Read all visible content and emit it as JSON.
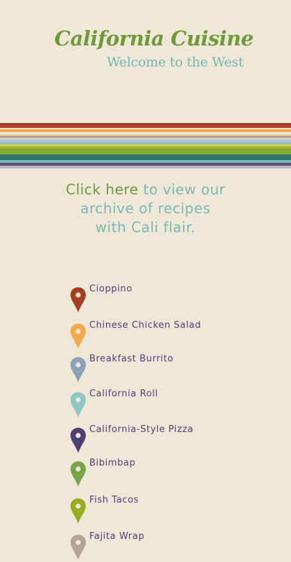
{
  "header": {
    "title": "California Cuisine",
    "tagline": "Welcome to the West"
  },
  "stripes": [
    {
      "color": "#9c3b2c",
      "h": 3
    },
    {
      "color": "#b8402c",
      "h": 4
    },
    {
      "color": "#efe7d7",
      "h": 2
    },
    {
      "color": "#f2a94a",
      "h": 4
    },
    {
      "color": "#efe7d7",
      "h": 2
    },
    {
      "color": "#e9d6b7",
      "h": 3
    },
    {
      "color": "#b3a092",
      "h": 3
    },
    {
      "color": "#d8ccc0",
      "h": 3
    },
    {
      "color": "#a8c8d6",
      "h": 4
    },
    {
      "color": "#8fb3c7",
      "h": 2
    },
    {
      "color": "#d3cf5c",
      "h": 3
    },
    {
      "color": "#a8b62f",
      "h": 3
    },
    {
      "color": "#84a832",
      "h": 9
    },
    {
      "color": "#2e7370",
      "h": 8
    },
    {
      "color": "#77b9b3",
      "h": 4
    },
    {
      "color": "#5a4b7a",
      "h": 4
    },
    {
      "color": "#b9b1c4",
      "h": 4
    }
  ],
  "archive": {
    "link_text": "Click here",
    "rest_text": " to view our archive of recipes with Cali flair."
  },
  "recipes": [
    {
      "name": "Cioppino",
      "pin_color": "#a3401f"
    },
    {
      "name": "Chinese Chicken Salad",
      "pin_color": "#f2a94a"
    },
    {
      "name": "Breakfast Burrito",
      "pin_color": "#8da2b6"
    },
    {
      "name": "California Roll",
      "pin_color": "#8fc6c1"
    },
    {
      "name": "California-Style Pizza",
      "pin_color": "#4e3f73"
    },
    {
      "name": "Bibimbap",
      "pin_color": "#7aa34a"
    },
    {
      "name": "Fish Tacos",
      "pin_color": "#96ad22"
    },
    {
      "name": "Fajita Wrap",
      "pin_color": "#b6a494"
    }
  ]
}
